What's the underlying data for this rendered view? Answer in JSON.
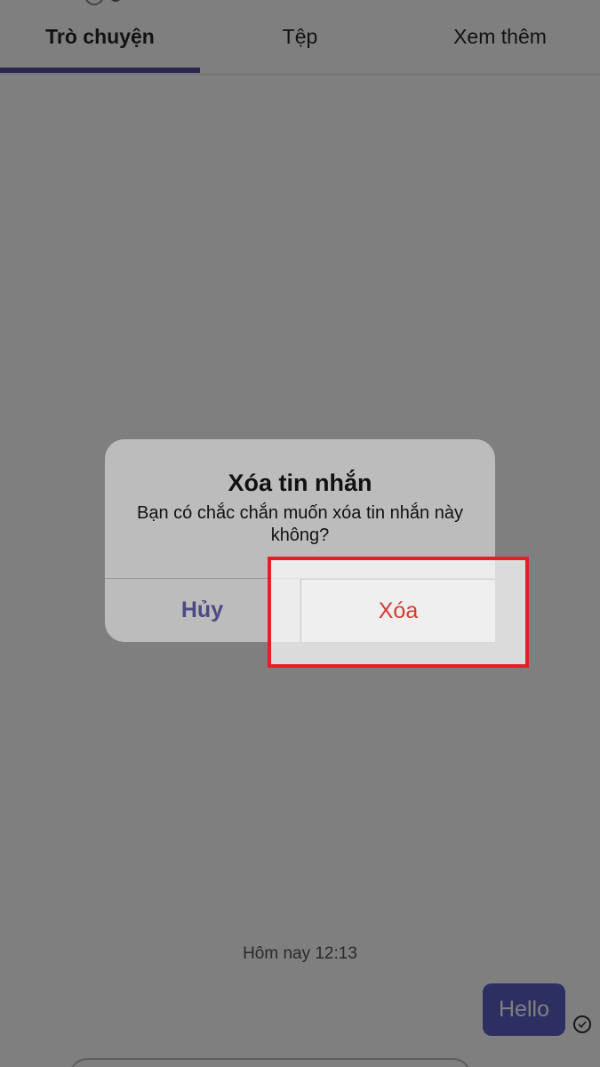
{
  "tabs": [
    {
      "label": "Trò chuyện",
      "active": true
    },
    {
      "label": "Tệp",
      "active": false
    },
    {
      "label": "Xem thêm",
      "active": false
    }
  ],
  "chat": {
    "timestamp": "Hôm nay 12:13",
    "message": "Hello"
  },
  "dialog": {
    "title": "Xóa tin nhắn",
    "message": "Bạn có chắc chắn muốn xóa tin nhắn này không?",
    "cancel_label": "Hủy",
    "delete_label": "Xóa"
  },
  "colors": {
    "accent": "#5b5fc7",
    "destructive": "#d53c31",
    "highlight": "#e81e24"
  }
}
